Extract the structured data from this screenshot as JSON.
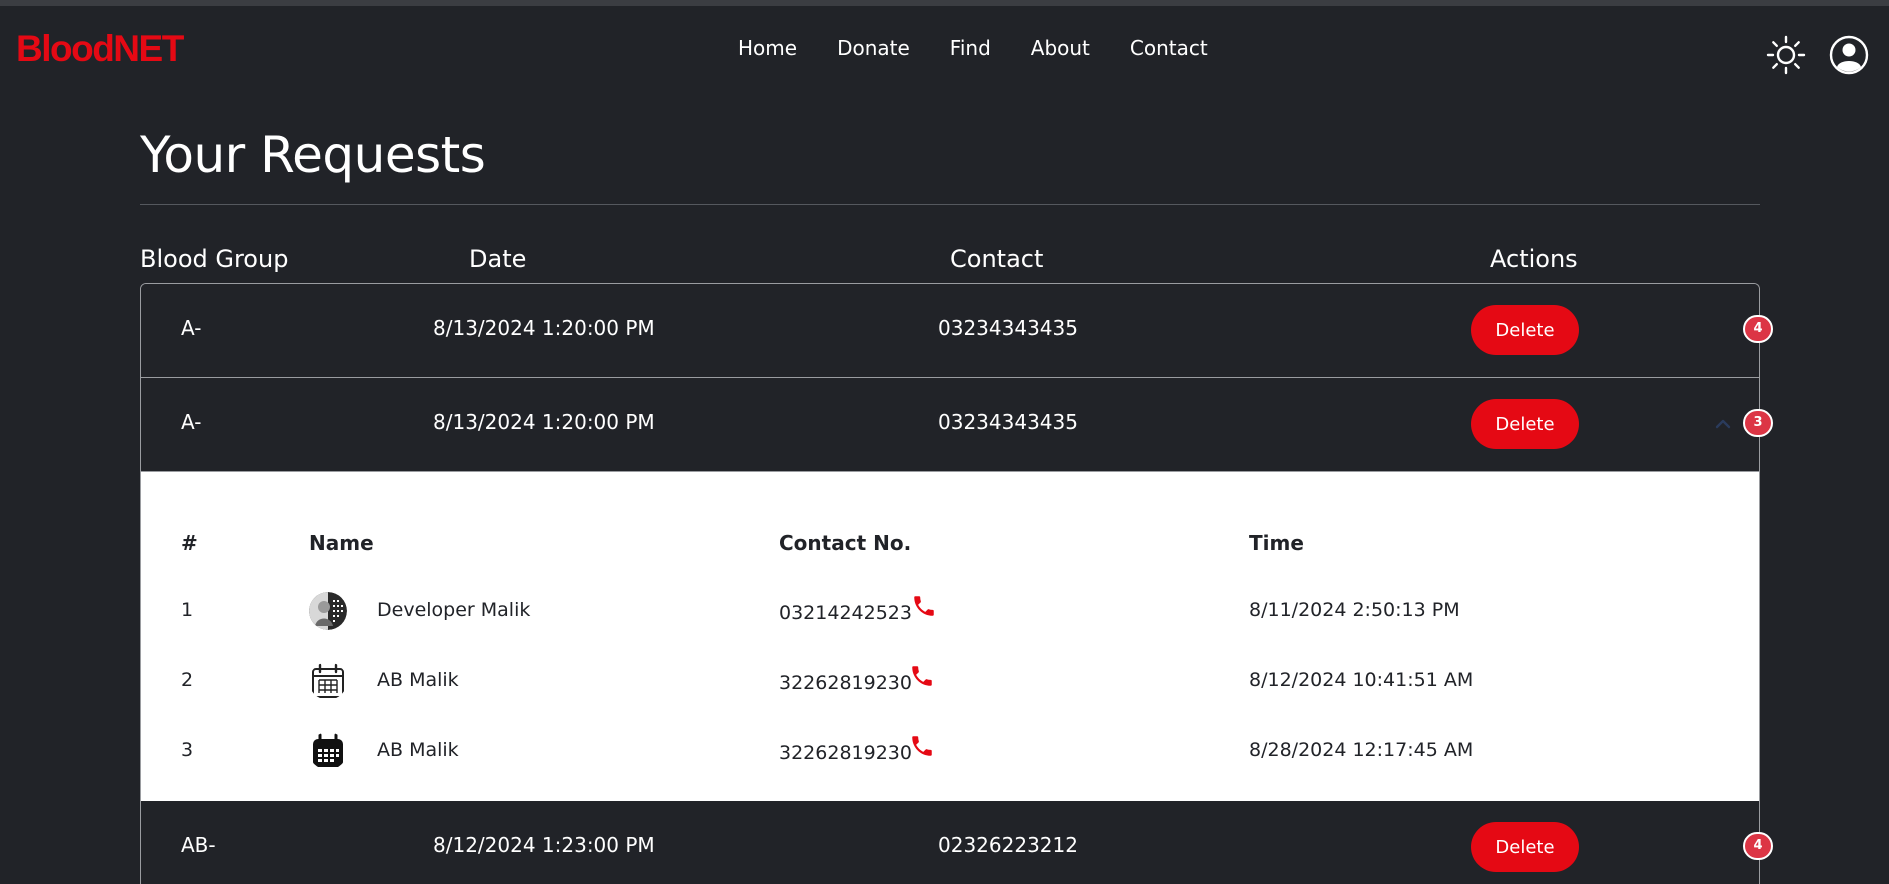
{
  "brand": "BloodNET",
  "nav": [
    "Home",
    "Donate",
    "Find",
    "About",
    "Contact"
  ],
  "page_title": "Your Requests",
  "columns": {
    "blood_group": "Blood Group",
    "date": "Date",
    "contact": "Contact",
    "actions": "Actions"
  },
  "requests": [
    {
      "blood_group": "A-",
      "date": "8/13/2024 1:20:00 PM",
      "contact": "03234343435",
      "action": "Delete",
      "count": "4"
    },
    {
      "blood_group": "A-",
      "date": "8/13/2024 1:20:00 PM",
      "contact": "03234343435",
      "action": "Delete",
      "count": "3",
      "expanded": true
    },
    {
      "blood_group": "AB-",
      "date": "8/12/2024 1:23:00 PM",
      "contact": "02326223212",
      "action": "Delete",
      "count": "4"
    }
  ],
  "responses": {
    "headers": {
      "num": "#",
      "name": "Name",
      "contact": "Contact No.",
      "time": "Time"
    },
    "rows": [
      {
        "num": "1",
        "name": "Developer Malik",
        "contact": "03214242523",
        "time": "8/11/2024 2:50:13 PM",
        "avatar": "photo-avatar"
      },
      {
        "num": "2",
        "name": "AB Malik",
        "contact": "32262819230",
        "time": "8/12/2024 10:41:51 AM",
        "avatar": "calendar-outline-icon"
      },
      {
        "num": "3",
        "name": "AB Malik",
        "contact": "32262819230",
        "time": "8/28/2024 12:17:45 AM",
        "avatar": "calendar-filled-icon"
      }
    ]
  },
  "icons": {
    "theme": "sun-icon",
    "profile": "user-circle-icon",
    "call": "phone-icon"
  },
  "colors": {
    "accent": "#e50914",
    "badge": "#dc3545",
    "background": "#212328"
  }
}
